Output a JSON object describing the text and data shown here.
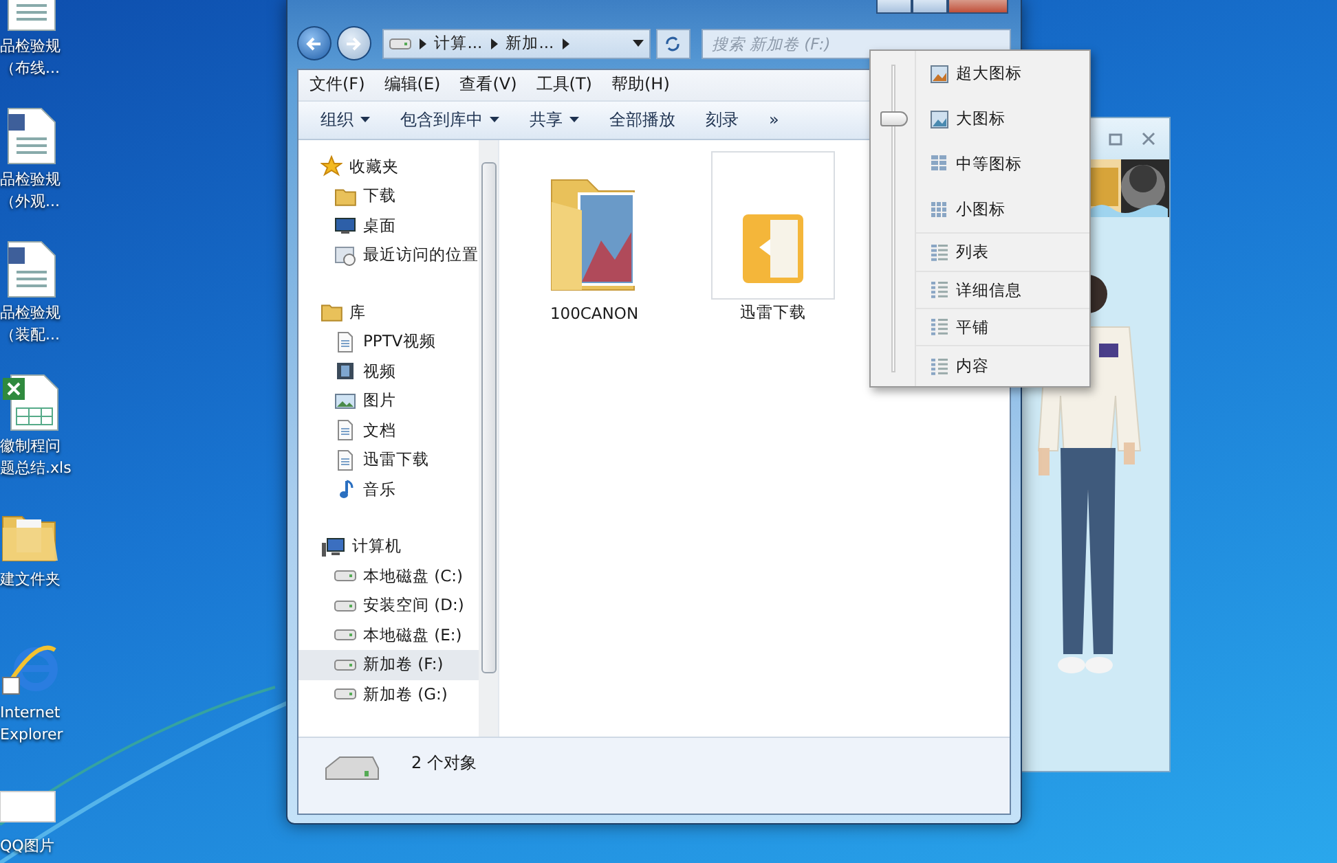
{
  "desktop_icons": [
    {
      "label": "品检验规（布线..."
    },
    {
      "label": "品检验规（外观..."
    },
    {
      "label": "品检验规（装配..."
    },
    {
      "label": "徽制程问题总结.xls"
    },
    {
      "label": "建文件夹"
    },
    {
      "label": "Internet Explorer"
    },
    {
      "label": "QQ图片"
    }
  ],
  "explorer": {
    "address": [
      "计算...",
      "新加..."
    ],
    "search": {
      "placeholder": "搜索 新加卷 (F:)"
    },
    "menu": [
      "文件(F)",
      "编辑(E)",
      "查看(V)",
      "工具(T)",
      "帮助(H)"
    ],
    "commands": [
      {
        "label": "组织",
        "dropdown": true
      },
      {
        "label": "包含到库中",
        "dropdown": true
      },
      {
        "label": "共享",
        "dropdown": true
      },
      {
        "label": "全部播放",
        "dropdown": false
      },
      {
        "label": "刻录",
        "dropdown": false
      },
      {
        "label": "»",
        "dropdown": false
      }
    ],
    "sidebar": [
      {
        "label": "收藏夹",
        "selected": false,
        "children": [
          {
            "label": "下载",
            "selected": false
          },
          {
            "label": "桌面",
            "selected": false
          },
          {
            "label": "最近访问的位置",
            "selected": false
          }
        ]
      },
      {
        "label": "库",
        "selected": false,
        "children": [
          {
            "label": "PPTV视频",
            "selected": false
          },
          {
            "label": "视频",
            "selected": false
          },
          {
            "label": "图片",
            "selected": false
          },
          {
            "label": "文档",
            "selected": false
          },
          {
            "label": "迅雷下载",
            "selected": false
          },
          {
            "label": "音乐",
            "selected": false
          }
        ]
      },
      {
        "label": "计算机",
        "selected": false,
        "children": [
          {
            "label": "本地磁盘 (C:)",
            "selected": false
          },
          {
            "label": "安装空间 (D:)",
            "selected": false
          },
          {
            "label": "本地磁盘 (E:)",
            "selected": false
          },
          {
            "label": "新加卷 (F:)",
            "selected": true
          },
          {
            "label": "新加卷 (G:)",
            "selected": false
          }
        ]
      }
    ],
    "files": [
      {
        "label": "100CANON",
        "selected": false
      },
      {
        "label": "迅雷下载",
        "selected": true
      }
    ],
    "status": "2 个对象"
  },
  "view_menu": {
    "items": [
      {
        "label": "超大图标",
        "selected": false
      },
      {
        "label": "大图标",
        "selected": true
      },
      {
        "label": "中等图标",
        "selected": false
      },
      {
        "label": "小图标",
        "selected": false
      },
      {
        "label": "列表",
        "selected": false
      },
      {
        "label": "详细信息",
        "selected": false
      },
      {
        "label": "平铺",
        "selected": false
      },
      {
        "label": "内容",
        "selected": false
      }
    ]
  }
}
